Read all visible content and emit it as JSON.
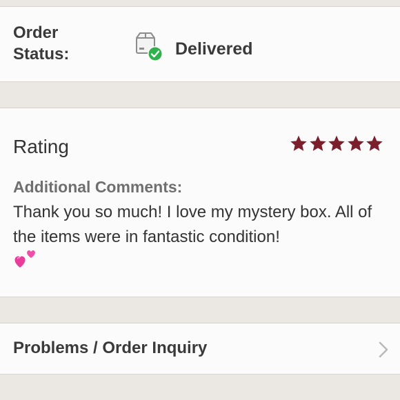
{
  "order_status": {
    "label": "Order Status:",
    "value": "Delivered",
    "icon": "delivered-box-icon",
    "check_color": "#2fb24c"
  },
  "rating": {
    "title": "Rating",
    "stars": 5,
    "max_stars": 5,
    "star_color": "#7a1f2b",
    "comments_heading": "Additional Comments:",
    "comments_text": "Thank you so much! I love my mystery box. All of the items were in fantastic condition!",
    "comments_emoji": "two-hearts-icon"
  },
  "inquiry": {
    "label": "Problems / Order Inquiry",
    "icon": "chevron-right-icon"
  }
}
